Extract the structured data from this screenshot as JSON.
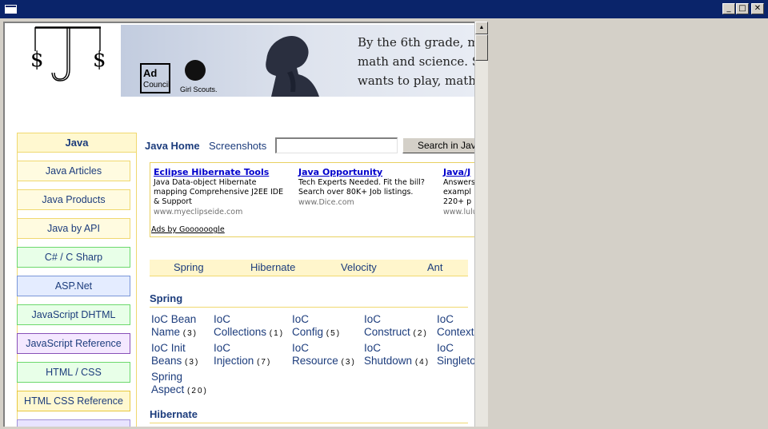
{
  "window": {
    "controls": {
      "minimize": "_",
      "maximize": "□",
      "close": "✕"
    }
  },
  "banner": {
    "quote_lines": [
      "By the 6th grade, m",
      "math and science. S",
      "wants to play, math"
    ],
    "adcouncil": [
      "Ad",
      "Council"
    ],
    "scouts": "Girl Scouts."
  },
  "nav": {
    "header": "Java",
    "items": [
      {
        "label": "Java Articles",
        "bg": "#fffbe0",
        "border": "#f0d870"
      },
      {
        "label": "Java Products",
        "bg": "#fffbe0",
        "border": "#f0d870"
      },
      {
        "label": "Java by API",
        "bg": "#fffbe0",
        "border": "#f0d870"
      },
      {
        "label": "C# / C Sharp",
        "bg": "#e8ffe8",
        "border": "#6cd86c"
      },
      {
        "label": "ASP.Net",
        "bg": "#e4ecff",
        "border": "#7a96d8"
      },
      {
        "label": "JavaScript DHTML",
        "bg": "#e8ffe8",
        "border": "#6cd86c"
      },
      {
        "label": "JavaScript Reference",
        "bg": "#f4e8ff",
        "border": "#8850b8"
      },
      {
        "label": "HTML / CSS",
        "bg": "#e8ffe8",
        "border": "#6cd86c"
      },
      {
        "label": "HTML CSS Reference",
        "bg": "#fff8d0",
        "border": "#e8c840"
      },
      {
        "label": "",
        "bg": "#e8e4ff",
        "border": "#a090d8"
      }
    ]
  },
  "topnav": {
    "java_home": "Java Home",
    "screenshots": "Screenshots",
    "search_value": "",
    "search_button": "Search in Java"
  },
  "ads": {
    "items": [
      {
        "title": "Eclipse Hibernate Tools",
        "desc": "Java Data-object Hibernate mapping Comprehensive J2EE IDE & Support",
        "url": "www.myeclipseide.com"
      },
      {
        "title": "Java Opportunity",
        "desc": "Tech Experts Needed. Fit the bill? Search over 80K+ Job listings.",
        "url": "www.Dice.com"
      },
      {
        "title": "Java/J",
        "desc": "Answers exampl 220+ p",
        "url": "www.lulu"
      }
    ],
    "footer": "Ads by Goooooogle"
  },
  "tabs": [
    "Spring",
    "Hibernate",
    "Velocity",
    "Ant"
  ],
  "sections": {
    "spring": {
      "title": "Spring",
      "items": [
        {
          "l1": "IoC Bean",
          "l2": "Name",
          "count": "(3)"
        },
        {
          "l1": "IoC",
          "l2": "Collections",
          "count": "(1)"
        },
        {
          "l1": "IoC",
          "l2": "Config",
          "count": "(5)"
        },
        {
          "l1": "IoC",
          "l2": "Construct",
          "count": "(2)"
        },
        {
          "l1": "IoC",
          "l2": "Context",
          "count": ""
        },
        {
          "l1": "IoC Init",
          "l2": "Beans",
          "count": "(3)"
        },
        {
          "l1": "IoC",
          "l2": "Injection",
          "count": "(7)"
        },
        {
          "l1": "IoC",
          "l2": "Resource",
          "count": "(3)"
        },
        {
          "l1": "IoC",
          "l2": "Shutdown",
          "count": "(4)"
        },
        {
          "l1": "IoC",
          "l2": "Singleto",
          "count": ""
        },
        {
          "l1": "Spring",
          "l2": "Aspect",
          "count": "(20)"
        }
      ]
    },
    "hibernate": {
      "title": "Hibernate"
    }
  }
}
